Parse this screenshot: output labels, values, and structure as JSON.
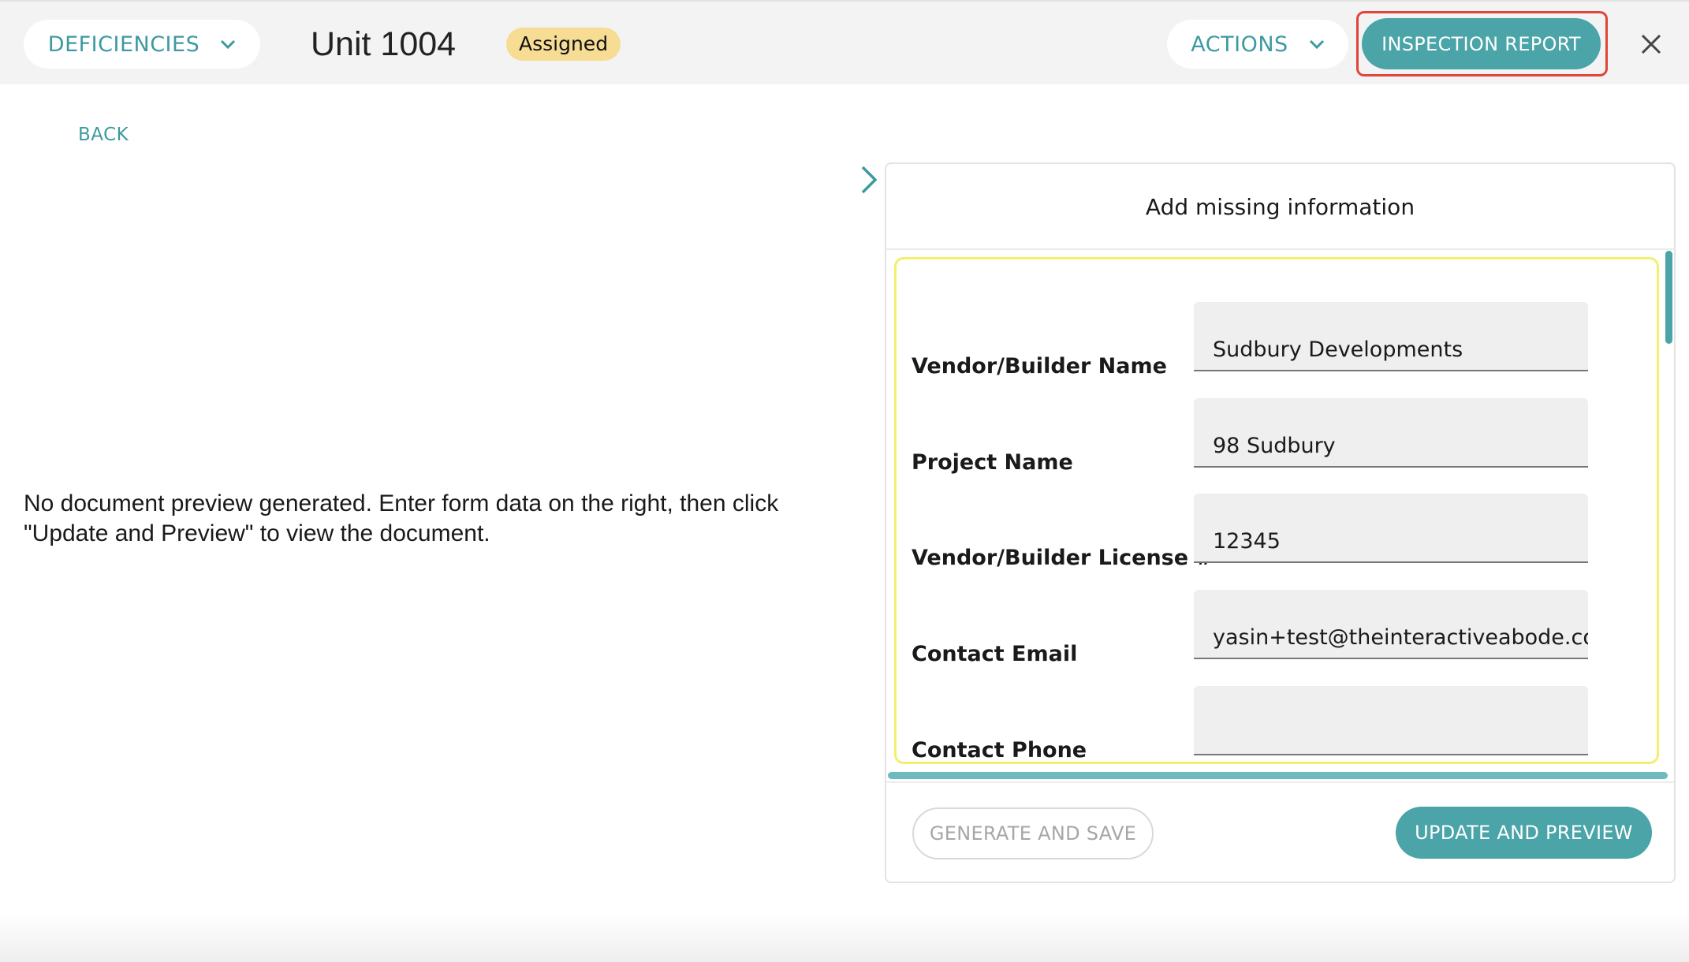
{
  "header": {
    "deficiencies_label": "DEFICIENCIES",
    "unit_title": "Unit 1004",
    "status_badge": "Assigned",
    "actions_label": "ACTIONS",
    "inspection_report_label": "INSPECTION REPORT"
  },
  "nav": {
    "back_label": "BACK"
  },
  "preview": {
    "message": "No document preview generated. Enter form data on the right, then click \"Update and Preview\" to view the document."
  },
  "panel": {
    "title": "Add missing information",
    "fields": [
      {
        "label": "Vendor/Builder Name",
        "value": "Sudbury Developments"
      },
      {
        "label": "Project Name",
        "value": "98 Sudbury"
      },
      {
        "label": "Vendor/Builder License #",
        "value": "12345"
      },
      {
        "label": "Contact Email",
        "value": "yasin+test@theinteractiveabode.com"
      },
      {
        "label": "Contact Phone",
        "value": ""
      }
    ],
    "generate_label": "GENERATE AND SAVE",
    "update_label": "UPDATE AND PREVIEW"
  },
  "colors": {
    "accent": "#4aa4a8",
    "badge": "#f7dc94",
    "highlight_red": "#e0453b",
    "form_outline": "#f2f06a"
  }
}
